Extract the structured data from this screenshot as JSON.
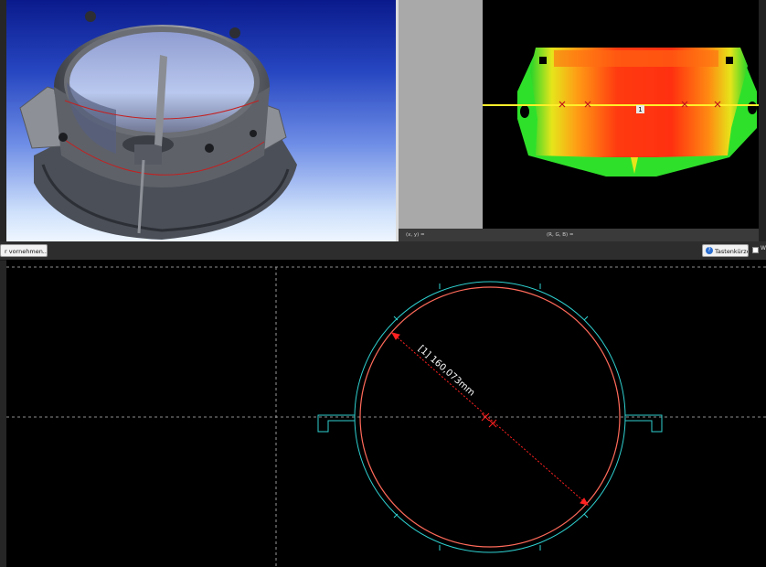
{
  "deviation_panel": {
    "status_xy": "(x, y) =",
    "status_rgb": "(R, G, B) =",
    "measure_label": "1"
  },
  "toolbar": {
    "action_button_label": "r vornehmen....",
    "shortcuts_button_label": "Tastenkürzel",
    "shortcuts_icon_glyph": "?",
    "checkbox_label": "W"
  },
  "section_view": {
    "diameter_label": "[1] 160,073mm"
  },
  "colors": {
    "outer_contour": "#2fd0d0",
    "fitted_circle": "#ff6a5a",
    "measurement_line": "#ff2020",
    "crosshair": "#bdbdbd"
  }
}
